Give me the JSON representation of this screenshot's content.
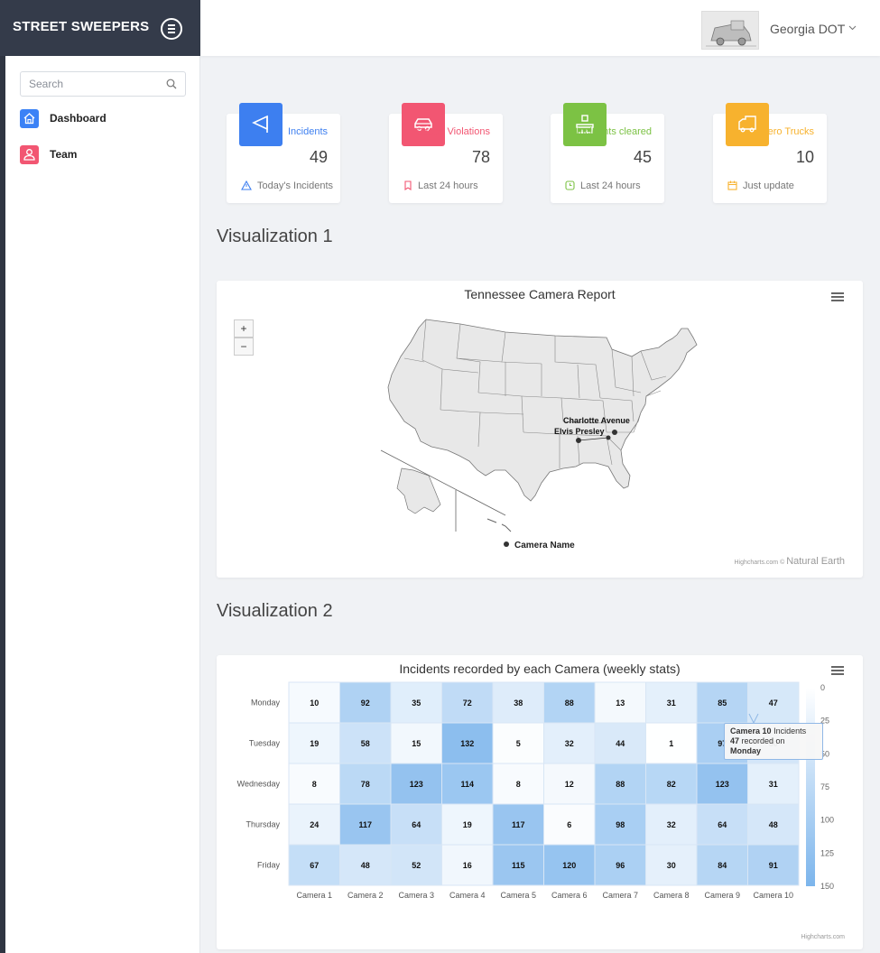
{
  "sidebar": {
    "brand": "STREET SWEEPERS",
    "search_placeholder": "Search",
    "items": [
      {
        "label": "Dashboard",
        "icon": "home-icon",
        "color": "#3b82f6"
      },
      {
        "label": "Team",
        "icon": "user-icon",
        "color": "#f25672"
      }
    ]
  },
  "header": {
    "user_name": "Georgia DOT"
  },
  "stats": [
    {
      "label": "Incidents",
      "value": "49",
      "foot": "Today's Incidents",
      "color": "#3d7ff0",
      "icon": "flag-icon"
    },
    {
      "label": "Speed Violations",
      "value": "78",
      "foot": "Last 24 hours",
      "color": "#f25672",
      "icon": "car-icon"
    },
    {
      "label": "Incidents cleared",
      "value": "45",
      "foot": "Last 24 hours",
      "color": "#7cc244",
      "icon": "broom-icon"
    },
    {
      "label": "Hero Trucks",
      "value": "10",
      "foot": "Just update",
      "color": "#f7b22e",
      "icon": "truck-icon"
    }
  ],
  "viz1": {
    "section_title": "Visualization 1",
    "chart_title": "Tennessee Camera Report",
    "zoom_in": "+",
    "zoom_out": "−",
    "points": [
      {
        "name": "Charlotte Avenue"
      },
      {
        "name": "Elvis Presley"
      }
    ],
    "legend": "Camera Name",
    "credit_small": "Highcharts.com © ",
    "credit_big": "Natural Earth"
  },
  "viz2": {
    "section_title": "Visualization 2",
    "credit": "Highcharts.com"
  },
  "chart_data": {
    "type": "heatmap",
    "title": "Incidents recorded by each Camera (weekly stats)",
    "x_categories": [
      "Camera 1",
      "Camera 2",
      "Camera 3",
      "Camera 4",
      "Camera 5",
      "Camera 6",
      "Camera 7",
      "Camera 8",
      "Camera 9",
      "Camera 10"
    ],
    "y_categories": [
      "Monday",
      "Tuesday",
      "Wednesday",
      "Thursday",
      "Friday"
    ],
    "values": [
      [
        10,
        92,
        35,
        72,
        38,
        88,
        13,
        31,
        85,
        47
      ],
      [
        19,
        58,
        15,
        132,
        5,
        32,
        44,
        1,
        97,
        50
      ],
      [
        8,
        78,
        123,
        114,
        8,
        12,
        88,
        82,
        123,
        31
      ],
      [
        24,
        117,
        64,
        19,
        117,
        6,
        98,
        32,
        64,
        48
      ],
      [
        67,
        48,
        52,
        16,
        115,
        120,
        96,
        30,
        84,
        91
      ]
    ],
    "color_axis": {
      "min": 0,
      "max": 150,
      "min_color": "#ffffff",
      "max_color": "#7cb5ec",
      "ticks": [
        0,
        25,
        50,
        75,
        100,
        125,
        150
      ]
    },
    "tooltip": {
      "camera": "Camera 10",
      "word_incidents": "Incidents",
      "value": "47",
      "mid": "recorded on",
      "day": "Monday"
    }
  }
}
